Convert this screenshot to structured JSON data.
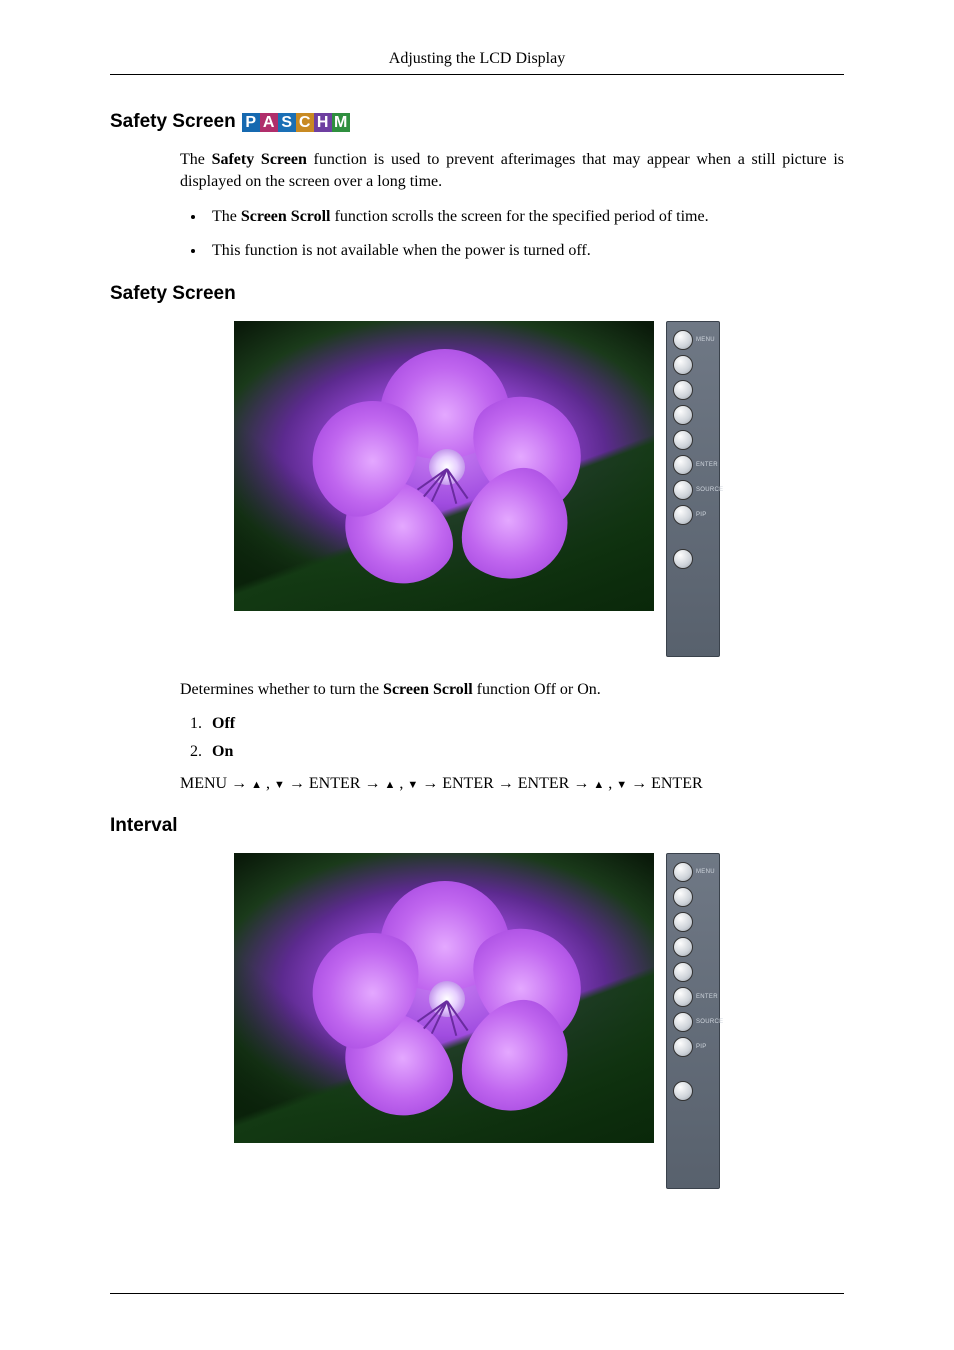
{
  "header": {
    "running_title": "Adjusting the LCD Display"
  },
  "badges": {
    "p": "P",
    "a": "A",
    "s": "S",
    "c": "C",
    "h": "H",
    "m": "M"
  },
  "section1": {
    "title": "Safety Screen",
    "intro_pre": "The ",
    "intro_bold": "Safety Screen",
    "intro_post": " function is used to prevent afterimages that may appear when a still picture is displayed on the screen over a long time.",
    "bullet1_pre": "The ",
    "bullet1_bold": "Screen Scroll",
    "bullet1_post": " function scrolls the screen for the specified period of time.",
    "bullet2": "This function is not available when the power is turned off."
  },
  "section2": {
    "title": "Safety Screen",
    "caption_pre": "Determines whether to turn the ",
    "caption_bold": "Screen Scroll",
    "caption_post": " function Off or On.",
    "opt1": "Off",
    "opt2": "On",
    "path_menu": "MENU",
    "path_enter": "ENTER",
    "path_sep_arrow": " → ",
    "path_sep_comma": " , "
  },
  "section3": {
    "title": "Interval"
  },
  "remote": {
    "b1": "MENU",
    "b2": "",
    "b3": "",
    "b4": "",
    "b5": "",
    "b6": "ENTER",
    "b7": "SOURCE",
    "b8": "PIP",
    "b9": ""
  }
}
